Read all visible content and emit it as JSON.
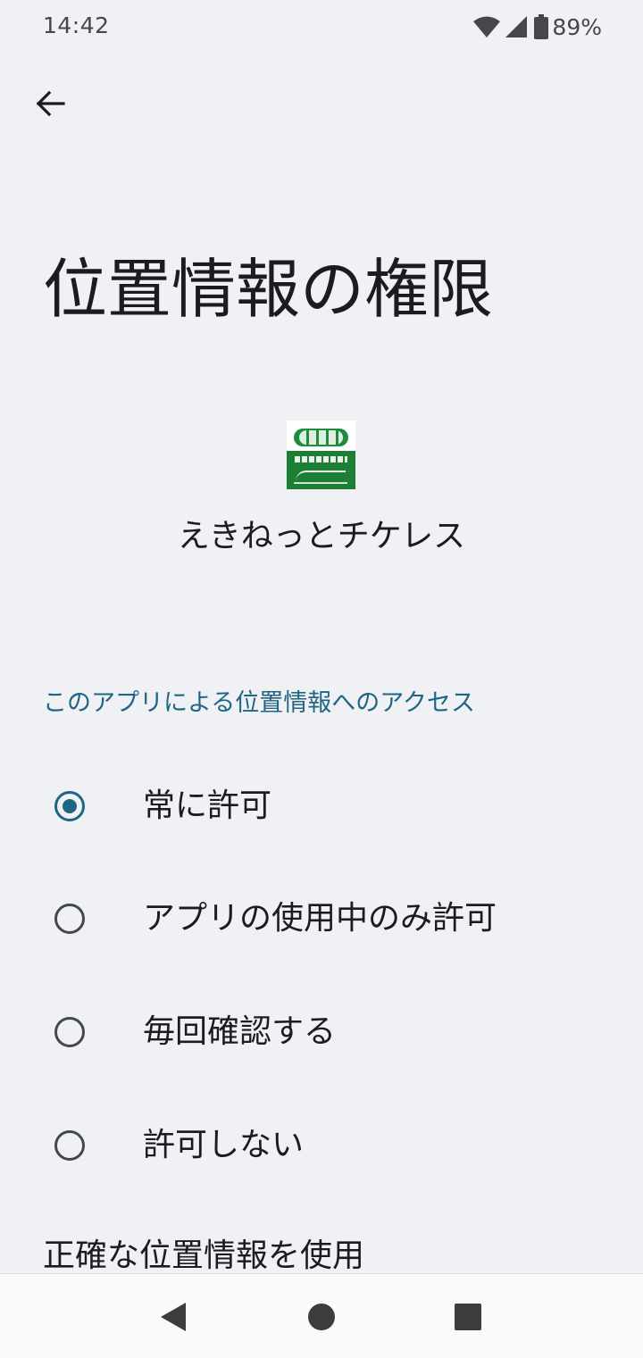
{
  "status_bar": {
    "time": "14:42",
    "battery_percent": "89%"
  },
  "page": {
    "title": "位置情報の権限"
  },
  "app": {
    "name": "えきねっとチケレス",
    "icon": "ekinet-ticketless-app-icon"
  },
  "section": {
    "header": "このアプリによる位置情報へのアクセス"
  },
  "options": [
    {
      "label": "常に許可",
      "selected": true
    },
    {
      "label": "アプリの使用中のみ許可",
      "selected": false
    },
    {
      "label": "毎回確認する",
      "selected": false
    },
    {
      "label": "許可しない",
      "selected": false
    }
  ],
  "footer": {
    "precise_location_label": "正確な位置情報を使用"
  },
  "colors": {
    "background": "#eff1f4",
    "accent": "#1f6683",
    "text": "#1b1c1f"
  },
  "icons": {
    "back": "arrow-back-icon",
    "wifi": "wifi-icon",
    "signal": "signal-icon",
    "battery": "battery-icon",
    "nav_back": "nav-back-triangle-icon",
    "nav_home": "nav-home-circle-icon",
    "nav_recents": "nav-recents-square-icon"
  }
}
